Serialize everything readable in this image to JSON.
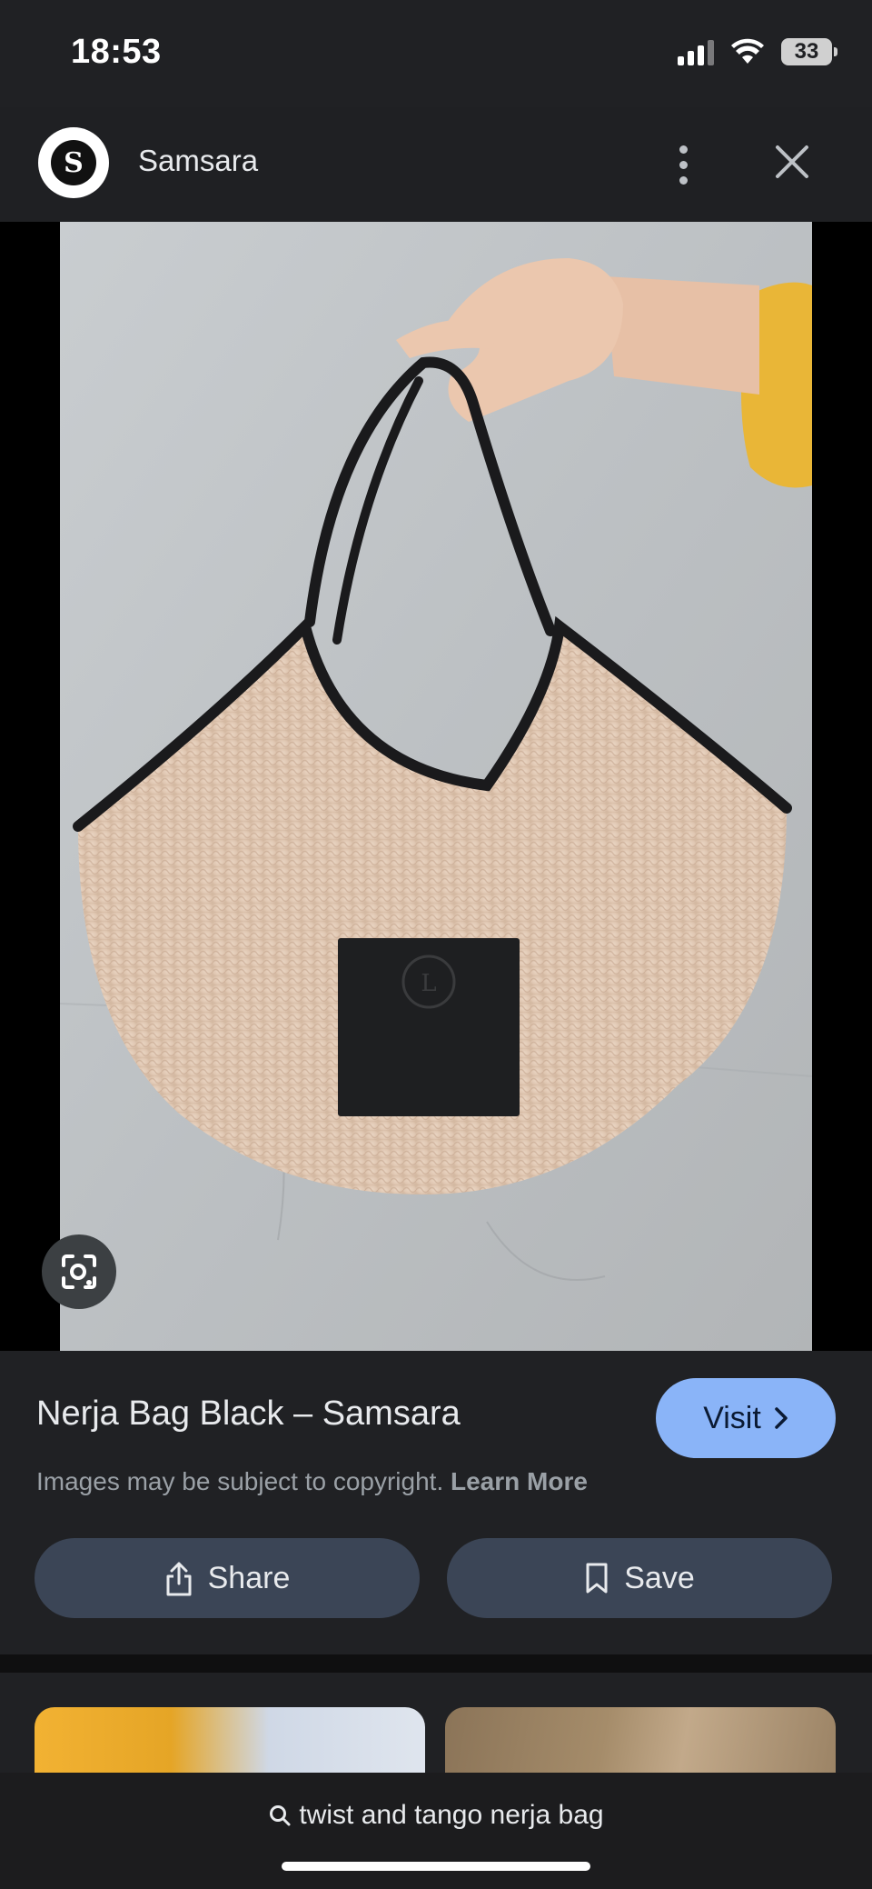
{
  "status_bar": {
    "time": "18:53",
    "battery": "33"
  },
  "header": {
    "site_name": "Samsara",
    "logo_letter": "S"
  },
  "result": {
    "title": "Nerja Bag Black – Samsara",
    "visit_label": "Visit",
    "copyright_text": "Images may be subject to copyright.",
    "learn_more": "Learn More",
    "share_label": "Share",
    "save_label": "Save"
  },
  "search": {
    "query": "twist and tango nerja bag"
  },
  "colors": {
    "accent": "#8ab4f8",
    "button_bg": "#3b4556",
    "background": "#202124"
  }
}
